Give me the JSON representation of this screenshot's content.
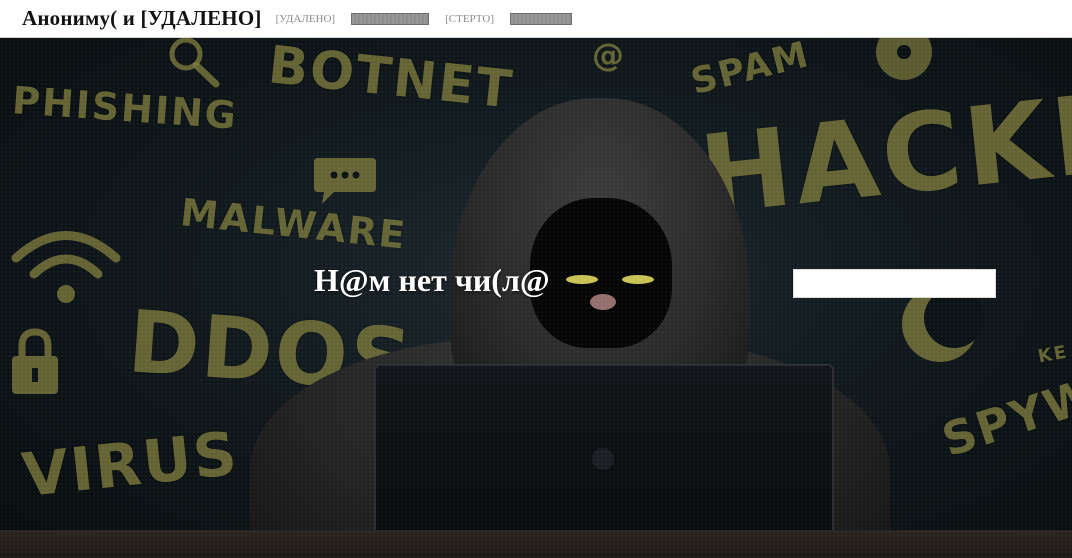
{
  "header": {
    "brand": "Анониму( и [УДАЛЕНО]",
    "nav": [
      {
        "label": "[УДАЛЕНО]",
        "type": "link"
      },
      {
        "label": "",
        "type": "redacted"
      },
      {
        "label": "[СТЕРТО]",
        "type": "link"
      },
      {
        "label": "",
        "type": "redacted"
      }
    ]
  },
  "hero": {
    "title": "Н@м нет чи(л@",
    "search": {
      "value": "",
      "placeholder": ""
    },
    "background_words": {
      "phishing": "PHISHING",
      "botnet": "BOTNET",
      "spam": "SPAM",
      "hacker": "HACKE",
      "malware": "MALWARE",
      "ddos": "DDOS",
      "virus": "VIRUS",
      "spyware": "SPYW",
      "keylogger": "KE"
    },
    "icons": [
      "magnifier-icon",
      "wifi-icon",
      "chat-bubble-icon",
      "at-sign-icon",
      "padlock-icon",
      "disc-icon",
      "moon-icon"
    ]
  },
  "colors": {
    "accent_olive": "#7c7a3c",
    "eyes": "#c9c254",
    "navbar_bg": "#ffffff",
    "redaction": "#8e8e8e"
  }
}
